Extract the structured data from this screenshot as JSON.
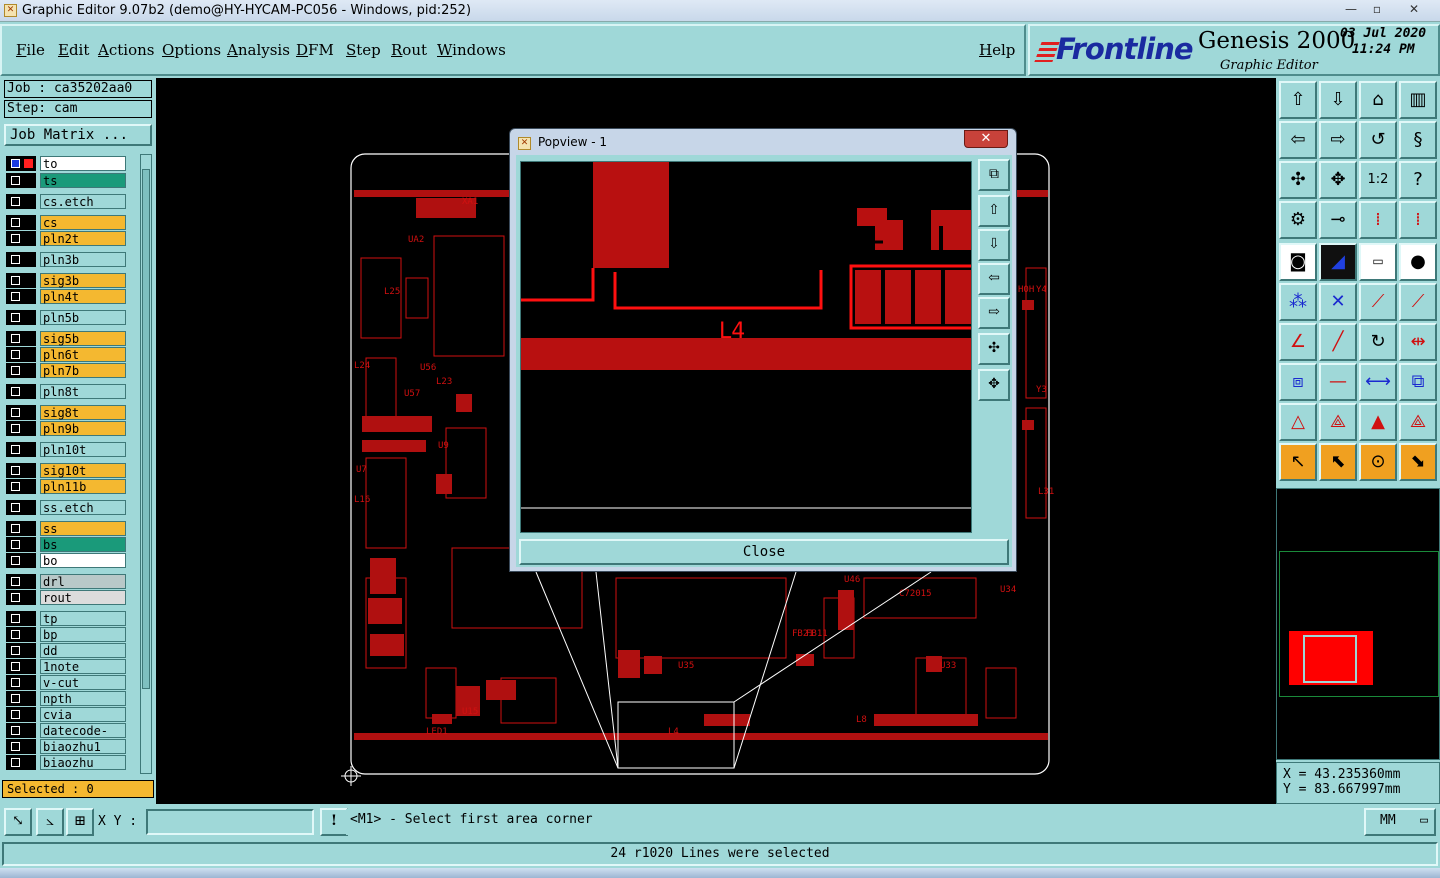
{
  "window": {
    "title": "Graphic Editor 9.07b2 (demo@HY-HYCAM-PC056 - Windows, pid:252)",
    "minimize": "—",
    "restore": "▫",
    "close": "✕"
  },
  "menu": [
    "File",
    "Edit",
    "Actions",
    "Options",
    "Analysis",
    "DFM",
    "Step",
    "Rout",
    "Windows"
  ],
  "help": "Help",
  "brand": {
    "logo": "Frontline",
    "product": "Genesis 2000",
    "subtitle": "Graphic Editor",
    "date": "03 Jul 2020",
    "time": "11:24 PM"
  },
  "job": {
    "job_label": "Job : ca35202aa0",
    "step_label": "Step: cam",
    "matrix_button": "Job Matrix ..."
  },
  "layers": [
    {
      "name": "to",
      "color": "#ffffff"
    },
    {
      "name": "ts",
      "color": "#1a9a7a"
    },
    {
      "name": "cs.etch",
      "color": "#9fd8d8"
    },
    {
      "name": "cs",
      "color": "#f4b830"
    },
    {
      "name": "pln2t",
      "color": "#f4b830"
    },
    {
      "name": "pln3b",
      "color": "#9fd8d8"
    },
    {
      "name": "sig3b",
      "color": "#f4b830"
    },
    {
      "name": "pln4t",
      "color": "#f4b830"
    },
    {
      "name": "pln5b",
      "color": "#9fd8d8"
    },
    {
      "name": "sig5b",
      "color": "#f4b830"
    },
    {
      "name": "pln6t",
      "color": "#f4b830"
    },
    {
      "name": "pln7b",
      "color": "#f4b830"
    },
    {
      "name": "pln8t",
      "color": "#9fd8d8"
    },
    {
      "name": "sig8t",
      "color": "#f4b830"
    },
    {
      "name": "pln9b",
      "color": "#f4b830"
    },
    {
      "name": "pln10t",
      "color": "#9fd8d8"
    },
    {
      "name": "sig10t",
      "color": "#f4b830"
    },
    {
      "name": "pln11b",
      "color": "#f4b830"
    },
    {
      "name": "ss.etch",
      "color": "#9fd8d8"
    },
    {
      "name": "ss",
      "color": "#f4b830"
    },
    {
      "name": "bs",
      "color": "#1a9a7a"
    },
    {
      "name": "bo",
      "color": "#ffffff"
    },
    {
      "name": "drl",
      "color": "#b8c8c8"
    },
    {
      "name": "rout",
      "color": "#dcdcdc"
    },
    {
      "name": "tp",
      "color": "#9fd8d8"
    },
    {
      "name": "bp",
      "color": "#9fd8d8"
    },
    {
      "name": "dd",
      "color": "#9fd8d8"
    },
    {
      "name": "1note",
      "color": "#9fd8d8"
    },
    {
      "name": "v-cut",
      "color": "#9fd8d8"
    },
    {
      "name": "npth",
      "color": "#9fd8d8"
    },
    {
      "name": "cvia",
      "color": "#9fd8d8"
    },
    {
      "name": "datecode-ptc",
      "color": "#9fd8d8"
    },
    {
      "name": "biaozhu1",
      "color": "#9fd8d8"
    },
    {
      "name": "biaozhu",
      "color": "#9fd8d8"
    }
  ],
  "selected": "Selected : 0",
  "popup": {
    "title": "Popview - 1",
    "close_button": "Close",
    "close_x": "✕",
    "view_label": "L4"
  },
  "canvas_labels": [
    "U46",
    "C72015",
    "U35",
    "U33",
    "U15",
    "L4",
    "L8",
    "LED1",
    "FB21",
    "FB11",
    "U34",
    "L23",
    "L24",
    "L16",
    "U9",
    "U7",
    "U56",
    "L25",
    "U57",
    "UA2",
    "XA1",
    "Y3",
    "Y4",
    "H0H",
    "L31"
  ],
  "coords": {
    "x": "X = 43.235360mm",
    "y": "Y = 83.667997mm"
  },
  "bottom": {
    "xy_label": "X Y :",
    "xy_value": "",
    "prompt": "<M1> - Select first area corner",
    "units": "MM",
    "alert_icon": "!"
  },
  "status": "24 r1020 Lines were selected",
  "colors": {
    "panel": "#9fd8d8",
    "board": "#ff0000",
    "canvas": "#000000",
    "accent_orange": "#f4b830"
  }
}
